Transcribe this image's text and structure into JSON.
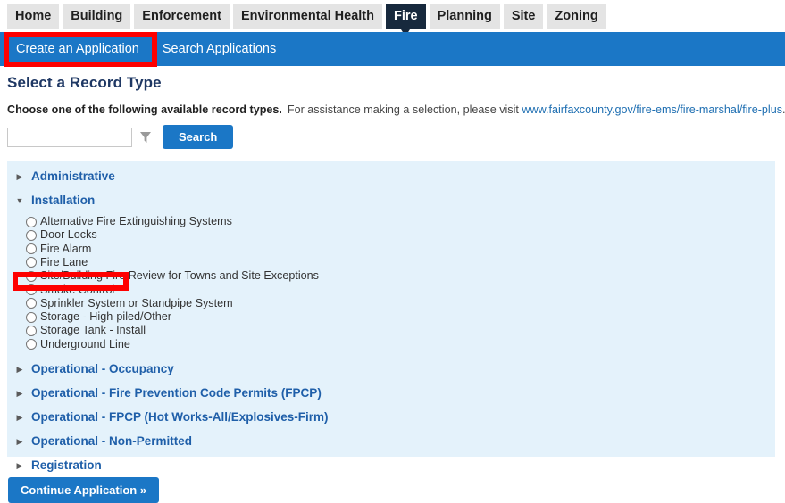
{
  "colors": {
    "accent_blue": "#1b77c6",
    "active_tab_navy": "#17293d",
    "panel_bg": "#e4f2fb",
    "annotation_red": "#fe0000",
    "group_link": "#1f5fa9",
    "title_navy": "#1f3864"
  },
  "module_tabs": [
    {
      "label": "Home",
      "active": false
    },
    {
      "label": "Building",
      "active": false
    },
    {
      "label": "Enforcement",
      "active": false
    },
    {
      "label": "Environmental Health",
      "active": false
    },
    {
      "label": "Fire",
      "active": true
    },
    {
      "label": "Planning",
      "active": false
    },
    {
      "label": "Site",
      "active": false
    },
    {
      "label": "Zoning",
      "active": false
    }
  ],
  "subnav": {
    "items": [
      {
        "label": "Create an Application",
        "active": true
      },
      {
        "label": "Search Applications",
        "active": false
      }
    ]
  },
  "page": {
    "title": "Select a Record Type",
    "instructions_bold": "Choose one of the following available record types.",
    "instructions_rest": "For assistance making a selection, please visit",
    "instructions_link": "www.fairfaxcounty.gov/fire-ems/fire-marshal/fire-plus",
    "instructions_period": "."
  },
  "search": {
    "value": "",
    "placeholder": "",
    "filter_icon": "filter-funnel-icon",
    "button_label": "Search"
  },
  "record_groups": [
    {
      "label": "Administrative",
      "expanded": false,
      "arrow": "chevron-right-icon",
      "items": []
    },
    {
      "label": "Installation",
      "expanded": true,
      "arrow": "chevron-down-icon",
      "items": [
        {
          "label": "Alternative Fire Extinguishing Systems",
          "selected": false
        },
        {
          "label": "Door Locks",
          "selected": false
        },
        {
          "label": "Fire Alarm",
          "selected": false
        },
        {
          "label": "Fire Lane",
          "selected": false
        },
        {
          "label": "Site/Building Fire Review for Towns and Site Exceptions",
          "selected": false
        },
        {
          "label": "Smoke Control",
          "selected": false
        },
        {
          "label": "Sprinkler System or Standpipe System",
          "selected": false
        },
        {
          "label": "Storage - High-piled/Other",
          "selected": false
        },
        {
          "label": "Storage Tank - Install",
          "selected": false
        },
        {
          "label": "Underground Line",
          "selected": false
        }
      ]
    },
    {
      "label": "Operational - Occupancy",
      "expanded": false,
      "arrow": "chevron-right-icon",
      "items": []
    },
    {
      "label": "Operational - Fire Prevention Code Permits (FPCP)",
      "expanded": false,
      "arrow": "chevron-right-icon",
      "items": []
    },
    {
      "label": "Operational - FPCP (Hot Works-All/Explosives-Firm)",
      "expanded": false,
      "arrow": "chevron-right-icon",
      "items": []
    },
    {
      "label": "Operational - Non-Permitted",
      "expanded": false,
      "arrow": "chevron-right-icon",
      "items": []
    },
    {
      "label": "Registration",
      "expanded": false,
      "arrow": "chevron-right-icon",
      "items": []
    }
  ],
  "footer": {
    "continue_label": "Continue Application »"
  },
  "annotations": [
    {
      "name": "create-an-application-highlight",
      "target": "Create an Application"
    },
    {
      "name": "smoke-control-highlight",
      "target": "Smoke Control"
    }
  ]
}
